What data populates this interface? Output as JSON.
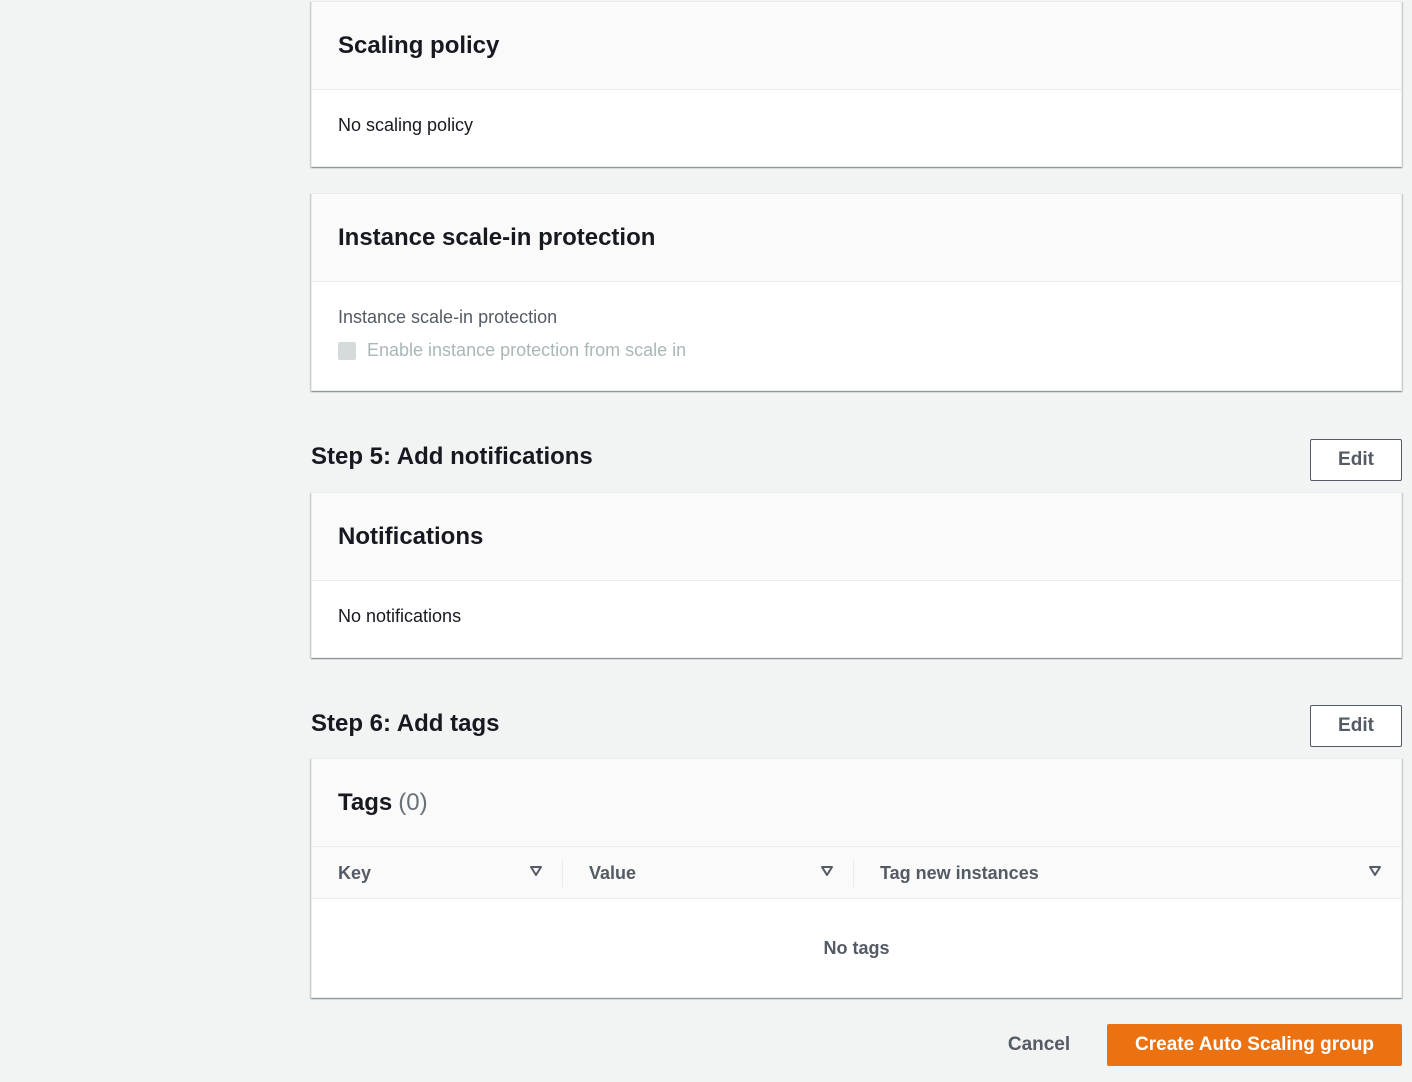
{
  "scaling_policy": {
    "title": "Scaling policy",
    "body": "No scaling policy"
  },
  "scale_in_protection": {
    "title": "Instance scale-in protection",
    "field_label": "Instance scale-in protection",
    "checkbox_label": "Enable instance protection from scale in",
    "checked": false,
    "disabled": true
  },
  "step5": {
    "title": "Step 5: Add notifications",
    "edit_label": "Edit",
    "card_title": "Notifications",
    "body": "No notifications"
  },
  "step6": {
    "title": "Step 6: Add tags",
    "edit_label": "Edit",
    "card_title": "Tags",
    "count": "(0)",
    "columns": [
      "Key",
      "Value",
      "Tag new instances"
    ],
    "empty_text": "No tags"
  },
  "footer": {
    "cancel_label": "Cancel",
    "create_label": "Create Auto Scaling group"
  },
  "colors": {
    "primary_button": "#ec7211",
    "background": "#f2f3f3",
    "card_header": "#fafafa",
    "muted_text": "#545b64"
  },
  "icons": {
    "sort": "caret-down-outline-icon"
  }
}
